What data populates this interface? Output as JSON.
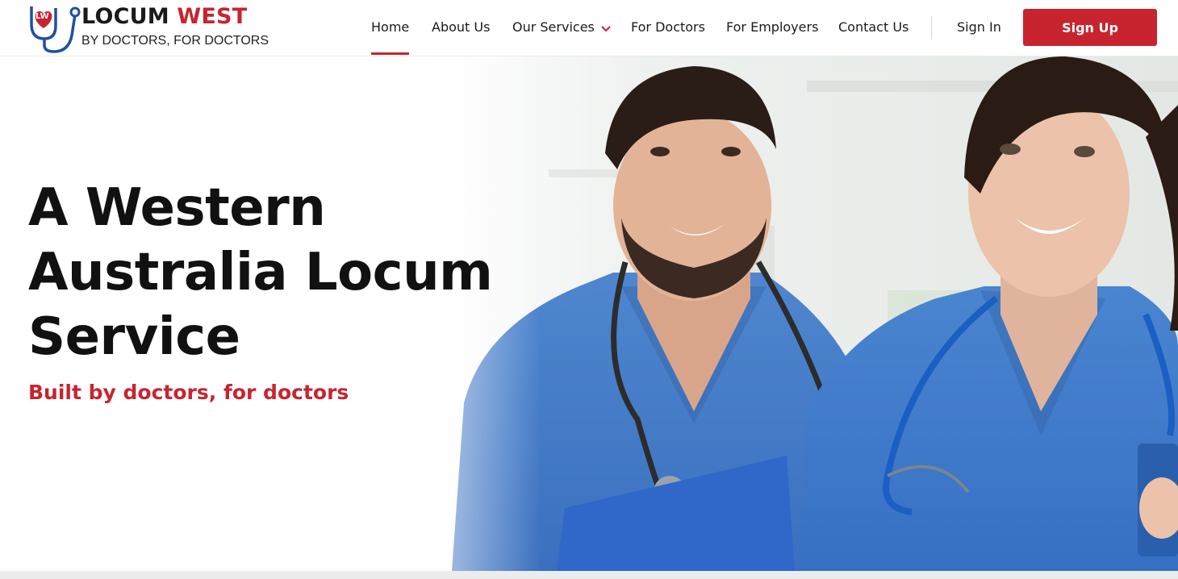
{
  "brand": {
    "logo_badge": "LW",
    "name_part1": "LOCUM",
    "name_part2": "WEST",
    "tagline": "BY DOCTORS, FOR DOCTORS",
    "primary_color": "#c8242f",
    "secondary_color": "#1f4fa3"
  },
  "nav": {
    "items": [
      {
        "label": "Home",
        "active": true
      },
      {
        "label": "About Us"
      },
      {
        "label": "Our Services",
        "icon": "chevron-down-icon"
      },
      {
        "label": "For Doctors"
      },
      {
        "label": "For Employers"
      },
      {
        "label": "Contact Us"
      }
    ],
    "sign_in": "Sign In",
    "sign_up": "Sign Up"
  },
  "hero": {
    "title_line1": "A Western",
    "title_line2": "Australia Locum",
    "title_line3": "Service",
    "subtitle": "Built by doctors, for doctors",
    "image": "two-doctors-in-blue-scrubs-with-stethoscopes"
  }
}
